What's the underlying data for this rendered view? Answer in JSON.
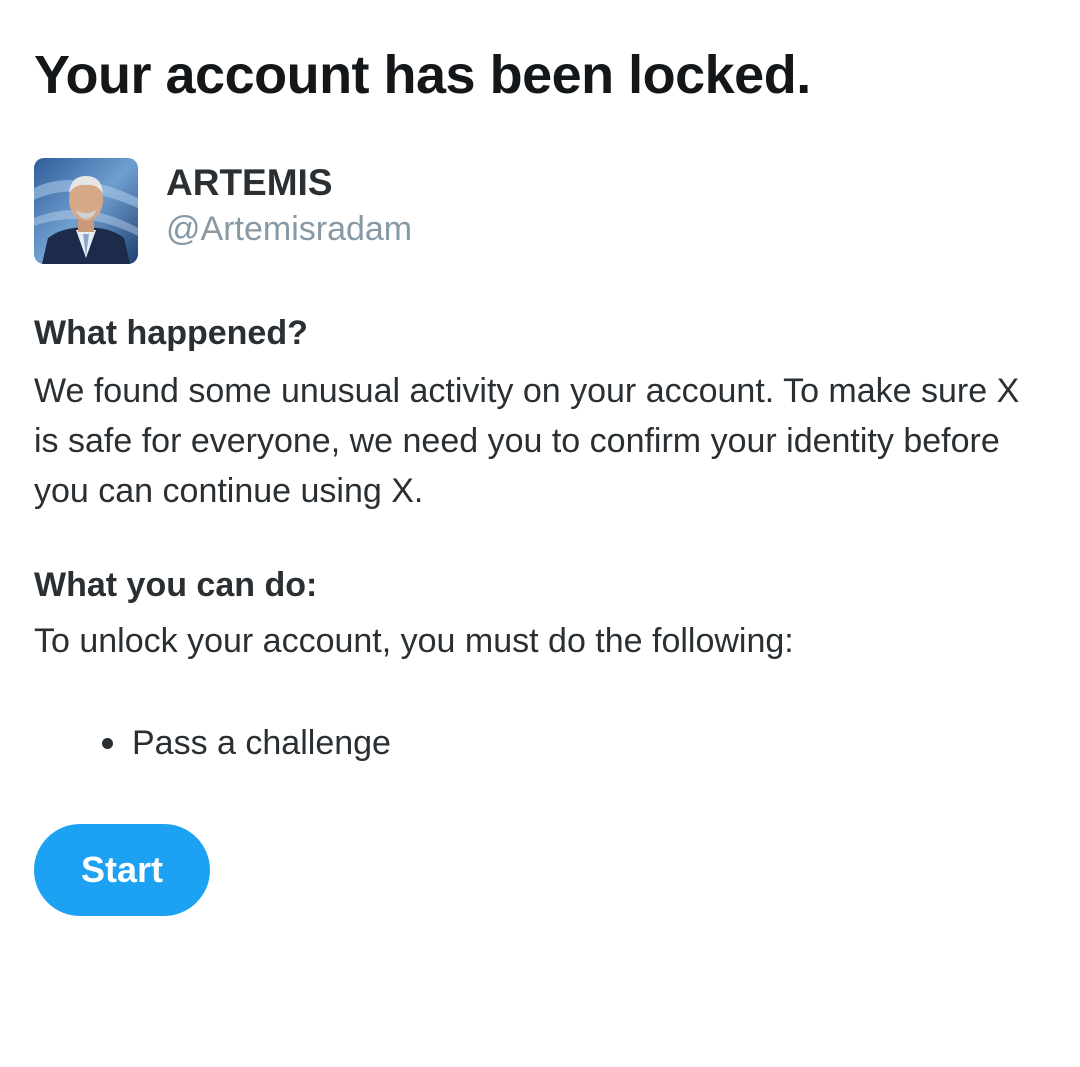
{
  "page": {
    "title": "Your account has been locked."
  },
  "profile": {
    "display_name": "ARTEMIS",
    "handle": "@Artemisradam"
  },
  "what_happened": {
    "heading": "What happened?",
    "text": "We found some unusual activity on your account. To make sure X is safe for everyone, we need you to confirm your identity before you can continue using X."
  },
  "what_you_can_do": {
    "heading": "What you can do:",
    "text": "To unlock your account, you must do the following:",
    "steps": [
      {
        "label": "Pass a challenge"
      }
    ]
  },
  "actions": {
    "start_label": "Start"
  },
  "colors": {
    "accent": "#1da1f2",
    "text_primary": "#14171a",
    "text_secondary": "#8899a6"
  }
}
